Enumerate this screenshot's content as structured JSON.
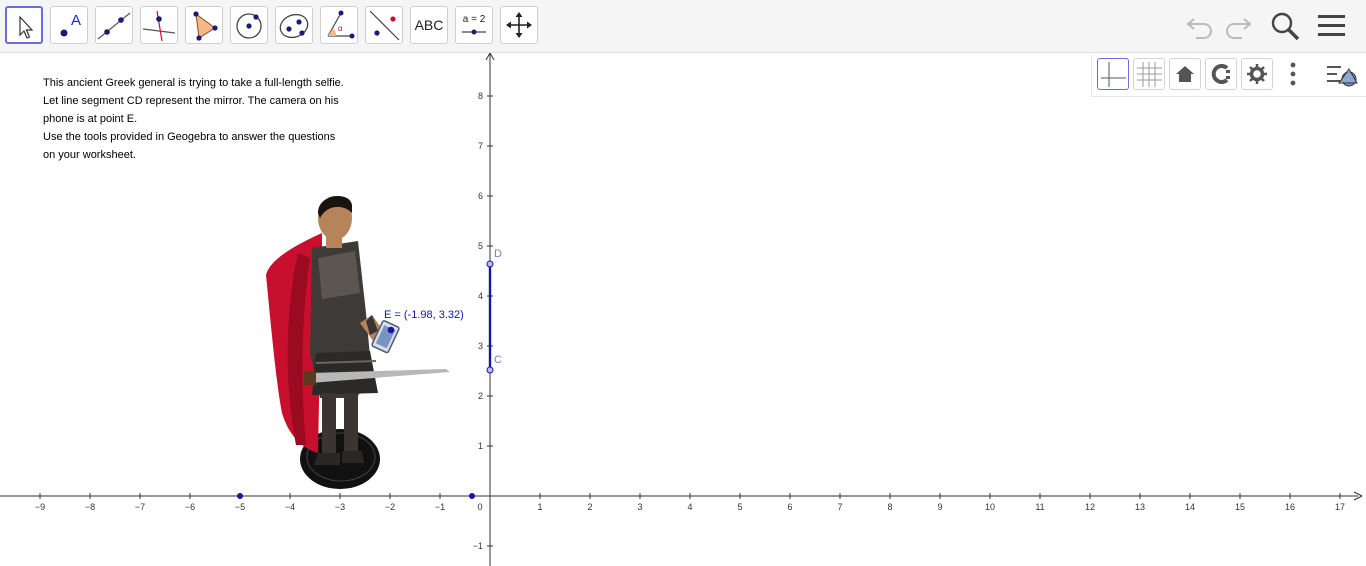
{
  "app": "GeoGebra",
  "toolbar": {
    "tools": [
      {
        "name": "move-tool",
        "selected": true
      },
      {
        "name": "point-tool",
        "label": "A"
      },
      {
        "name": "line-tool"
      },
      {
        "name": "perpendicular-line-tool"
      },
      {
        "name": "polygon-tool"
      },
      {
        "name": "circle-center-point-tool"
      },
      {
        "name": "ellipse-tool"
      },
      {
        "name": "angle-tool",
        "label": "α"
      },
      {
        "name": "reflect-about-line-tool"
      },
      {
        "name": "text-tool",
        "label": "ABC"
      },
      {
        "name": "slider-tool",
        "label": "a = 2"
      },
      {
        "name": "move-graphics-view-tool"
      }
    ],
    "right_icons": [
      "undo-icon",
      "redo-icon",
      "search-icon",
      "menu-icon"
    ]
  },
  "style_bar": {
    "buttons": [
      "axes-icon",
      "grid-icon",
      "home-icon",
      "point-capturing-icon",
      "settings-icon",
      "more-icon",
      "style-bar-toggle-icon"
    ],
    "active": "axes-icon"
  },
  "description": {
    "lines": [
      "This ancient Greek general is trying to take a full-length selfie.",
      "Let line segment CD represent the mirror. The camera on his",
      "phone is at point E.",
      "Use the tools provided in Geogebra to answer the questions",
      "on your worksheet."
    ]
  },
  "graphics": {
    "x_ticks": [
      "−9",
      "−8",
      "−7",
      "−6",
      "−5",
      "−4",
      "−3",
      "−2",
      "−1",
      "0",
      "1",
      "2",
      "3",
      "4",
      "5",
      "6",
      "7",
      "8",
      "9",
      "10",
      "11",
      "12",
      "13",
      "14",
      "15",
      "16",
      "17"
    ],
    "y_ticks": [
      "−1",
      "1",
      "2",
      "3",
      "4",
      "5",
      "6",
      "7",
      "8"
    ],
    "points": {
      "C": {
        "label": "C",
        "x": 0,
        "y": 2.52
      },
      "D": {
        "label": "D",
        "x": 0,
        "y": 4.65
      },
      "E": {
        "label": "E = (-1.98, 3.32)",
        "x": -1.98,
        "y": 3.32
      },
      "P1": {
        "x": -5,
        "y": 0
      },
      "P2": {
        "x": -0.35,
        "y": 0
      }
    },
    "colors": {
      "point": "#1515a8",
      "segment": "#1515a8",
      "label_cd": "#7a7ad0",
      "label_e": "#1515a8",
      "cape": "#c8102e"
    }
  }
}
